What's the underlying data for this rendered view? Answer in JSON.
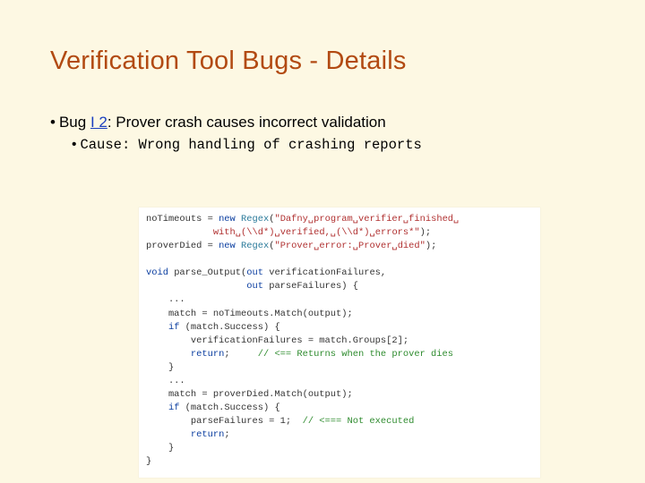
{
  "title": "Verification Tool Bugs - Details",
  "bullet": {
    "prefix": "Bug ",
    "link": "I 2",
    "suffix": ": Prover crash causes incorrect validation"
  },
  "cause": "Cause: Wrong handling of crashing reports",
  "code": {
    "l01a": "noTimeouts = ",
    "l01b": "new",
    "l01c": " Regex",
    "l01d": "(",
    "l01e": "\"Dafny␣program␣verifier␣finished␣",
    "l02a": "            with␣(\\\\d*)␣verified,␣(\\\\d*)␣errors*\"",
    "l02b": ");",
    "l03a": "proverDied = ",
    "l03b": "new",
    "l03c": " Regex",
    "l03d": "(",
    "l03e": "\"Prover␣error:␣Prover␣died\"",
    "l03f": ");",
    "blank1": " ",
    "l05a": "void",
    "l05b": " parse_Output(",
    "l05c": "out",
    "l05d": " verificationFailures,",
    "l06a": "                  ",
    "l06b": "out",
    "l06c": " parseFailures) {",
    "l07": "    ...",
    "l08": "    match = noTimeouts.Match(output);",
    "l09a": "    ",
    "l09b": "if",
    "l09c": " (match.Success) {",
    "l10": "        verificationFailures = match.Groups[2];",
    "l11a": "        ",
    "l11b": "return",
    "l11c": ";     ",
    "l11d": "// <== Returns when the prover dies",
    "l12": "    }",
    "l13": "    ...",
    "l14": "    match = proverDied.Match(output);",
    "l15a": "    ",
    "l15b": "if",
    "l15c": " (match.Success) {",
    "l16a": "        parseFailures = 1;  ",
    "l16b": "// <=== Not executed",
    "l17a": "        ",
    "l17b": "return",
    "l17c": ";",
    "l18": "    }",
    "l19": "}"
  }
}
